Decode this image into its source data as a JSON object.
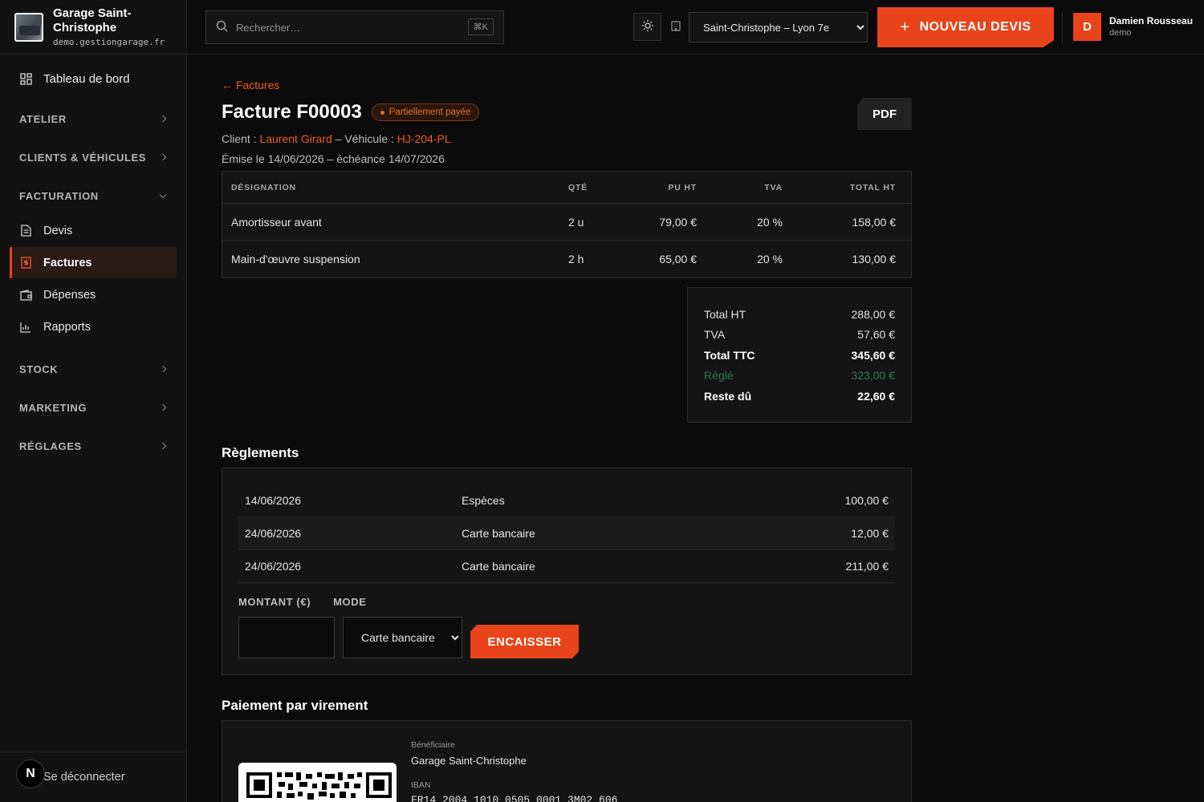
{
  "brand": {
    "name": "Garage Saint-Christophe",
    "domain": "demo.gestiongarage.fr"
  },
  "sidebar": {
    "dashboard": "Tableau de bord",
    "sections": {
      "atelier": "ATELIER",
      "clients": "CLIENTS & VÉHICULES",
      "facturation": "FACTURATION",
      "stock": "STOCK",
      "marketing": "MARKETING",
      "reglages": "RÉGLAGES"
    },
    "items": {
      "devis": "Devis",
      "factures": "Factures",
      "depenses": "Dépenses",
      "rapports": "Rapports"
    },
    "logout": "Se déconnecter",
    "badge": "N"
  },
  "topbar": {
    "search_placeholder": "Rechercher…",
    "shortcut": "⌘K",
    "site": "Saint-Christophe – Lyon 7e",
    "new_button": "NOUVEAU DEVIS",
    "user": {
      "initial": "D",
      "name": "Damien Rousseau",
      "role": "demo"
    }
  },
  "invoice": {
    "back": "← Factures",
    "title": "Facture F00003",
    "status": "Partiellement payée",
    "pdf": "PDF",
    "client_label": "Client :",
    "client": "Laurent Girard",
    "vehicle_label": "– Véhicule :",
    "vehicle": "HJ-204-PL",
    "dates": "Émise le 14/06/2026 – échéance 14/07/2026",
    "columns": [
      "DÉSIGNATION",
      "QTÉ",
      "PU HT",
      "TVA",
      "TOTAL HT"
    ],
    "lines": [
      {
        "designation": "Amortisseur avant",
        "qty": "2 u",
        "pu": "79,00 €",
        "tva": "20 %",
        "total": "158,00 €"
      },
      {
        "designation": "Main-d'œuvre suspension",
        "qty": "2 h",
        "pu": "65,00 €",
        "tva": "20 %",
        "total": "130,00 €"
      }
    ],
    "totals": {
      "ht_label": "Total HT",
      "ht": "288,00 €",
      "tva_label": "TVA",
      "tva": "57,60 €",
      "ttc_label": "Total TTC",
      "ttc": "345,60 €",
      "paid_label": "Réglé",
      "paid": "323,00 €",
      "due_label": "Reste dû",
      "due": "22,60 €"
    }
  },
  "payments": {
    "title": "Règlements",
    "rows": [
      {
        "date": "14/06/2026",
        "mode": "Espèces",
        "amount": "100,00 €"
      },
      {
        "date": "24/06/2026",
        "mode": "Carte bancaire",
        "amount": "12,00 €"
      },
      {
        "date": "24/06/2026",
        "mode": "Carte bancaire",
        "amount": "211,00 €"
      }
    ],
    "amount_label": "MONTANT (€)",
    "mode_label": "MODE",
    "mode_value": "Carte bancaire",
    "submit": "ENCAISSER"
  },
  "transfer": {
    "title": "Paiement par virement",
    "beneficiary_label": "Bénéficiaire",
    "beneficiary": "Garage Saint-Christophe",
    "iban_label": "IBAN",
    "iban": "FR14 2004 1010 0505 0001 3M02 606"
  },
  "colors": {
    "accent": "#e8431a",
    "paid": "#2e7a52"
  }
}
